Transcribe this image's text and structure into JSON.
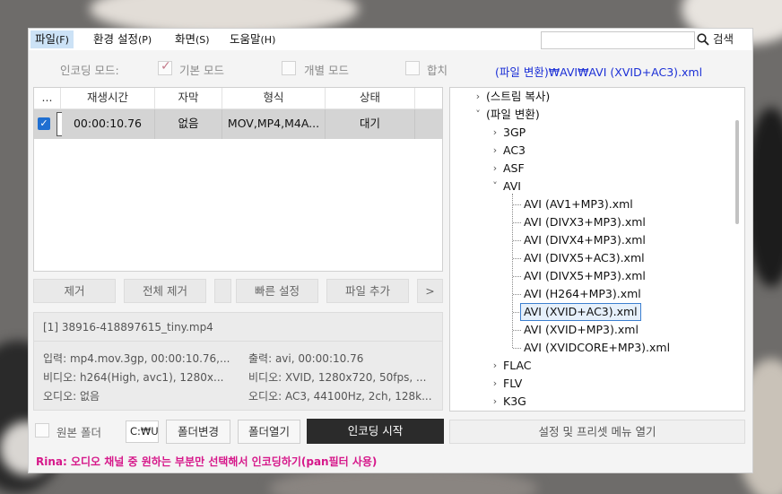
{
  "menu": {
    "items": [
      {
        "label": "파일",
        "hotkey": "(F)"
      },
      {
        "label": "환경 설정",
        "hotkey": "(P)"
      },
      {
        "label": "화면",
        "hotkey": "(S)"
      },
      {
        "label": "도움말",
        "hotkey": "(H)"
      }
    ],
    "search_label": "검색"
  },
  "mode": {
    "label": "인코딩 모드:",
    "basic": "기본 모드",
    "individual": "개별 모드",
    "merge": "합치"
  },
  "preset_path": "(파일 변환)₩AVI₩AVI (XVID+AC3).xml",
  "table": {
    "columns": [
      "...",
      "재생시간",
      "자막",
      "형식",
      "상태"
    ],
    "rows": [
      {
        "duration": "00:00:10.76",
        "subtitle": "없음",
        "format": "MOV,MP4,M4A...",
        "status": "대기"
      }
    ]
  },
  "buttons": {
    "remove": "제거",
    "remove_all": "전체 제거",
    "quick_settings": "빠른 설정",
    "add_file": "파일 추가",
    "more": ">",
    "change_folder": "폴더변경",
    "open_folder": "폴더열기",
    "start_encoding": "인코딩 시작",
    "open_settings_menu": "설정 및 프리셋 메뉴 열기"
  },
  "info": {
    "file": "[1] 38916-418897615_tiny.mp4",
    "input": "입력: mp4.mov.3gp, 00:00:10.76,...",
    "output": "출력: avi, 00:00:10.76",
    "video_in": "비디오: h264(High, avc1), 1280x...",
    "video_out": "비디오: XVID, 1280x720, 50fps, ...",
    "audio_in": "오디오: 없음",
    "audio_out": "오디오: AC3, 44100Hz, 2ch, 128k..."
  },
  "tree": {
    "stream_copy": "(스트림 복사)",
    "file_convert": "(파일 변환)",
    "formats_before": [
      "3GP",
      "AC3",
      "ASF"
    ],
    "avi": "AVI",
    "avi_presets": [
      "AVI (AV1+MP3).xml",
      "AVI (DIVX3+MP3).xml",
      "AVI (DIVX4+MP3).xml",
      "AVI (DIVX5+AC3).xml",
      "AVI (DIVX5+MP3).xml",
      "AVI (H264+MP3).xml",
      "AVI (XVID+AC3).xml",
      "AVI (XVID+MP3).xml",
      "AVI (XVIDCORE+MP3).xml"
    ],
    "formats_after": [
      "FLAC",
      "FLV",
      "K3G"
    ]
  },
  "bottom": {
    "source_folder_label": "원본 폴더",
    "folder_path": "C:₩Users"
  },
  "status_text": "Rina: 오디오 채널 중 원하는 부분만 선택해서 인코딩하기(pan필터 사용)"
}
